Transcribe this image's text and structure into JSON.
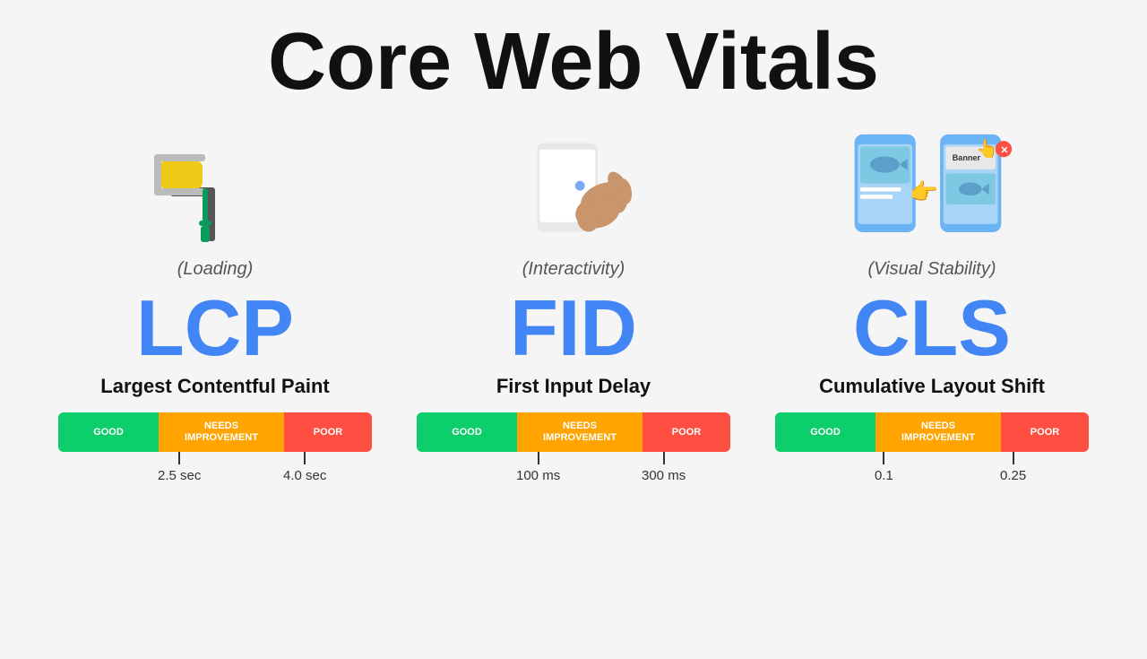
{
  "title": "Core Web Vitals",
  "metrics": [
    {
      "id": "lcp",
      "acronym": "LCP",
      "name": "Largest Contentful Paint",
      "category": "(Loading)",
      "bar": {
        "good_label": "GOOD",
        "needs_label": "NEEDS\nIMPROVEMENT",
        "poor_label": "POOR",
        "good_pct": 32,
        "needs_pct": 40,
        "poor_pct": 28
      },
      "thresholds": [
        {
          "label": "2.5 sec",
          "left_pct": 32
        },
        {
          "label": "4.0 sec",
          "left_pct": 72
        }
      ]
    },
    {
      "id": "fid",
      "acronym": "FID",
      "name": "First Input Delay",
      "category": "(Interactivity)",
      "bar": {
        "good_label": "GOOD",
        "needs_label": "NEEDS\nIMPROVEMENT",
        "poor_label": "POOR",
        "good_pct": 32,
        "needs_pct": 40,
        "poor_pct": 28
      },
      "thresholds": [
        {
          "label": "100 ms",
          "left_pct": 32
        },
        {
          "label": "300 ms",
          "left_pct": 72
        }
      ]
    },
    {
      "id": "cls",
      "acronym": "CLS",
      "name": "Cumulative Layout Shift",
      "category": "(Visual Stability)",
      "bar": {
        "good_label": "GOOD",
        "needs_label": "NEEDS\nIMPROVEMENT",
        "poor_label": "POOR",
        "good_pct": 32,
        "needs_pct": 40,
        "poor_pct": 28
      },
      "thresholds": [
        {
          "label": "0.1",
          "left_pct": 32
        },
        {
          "label": "0.25",
          "left_pct": 72
        }
      ]
    }
  ]
}
